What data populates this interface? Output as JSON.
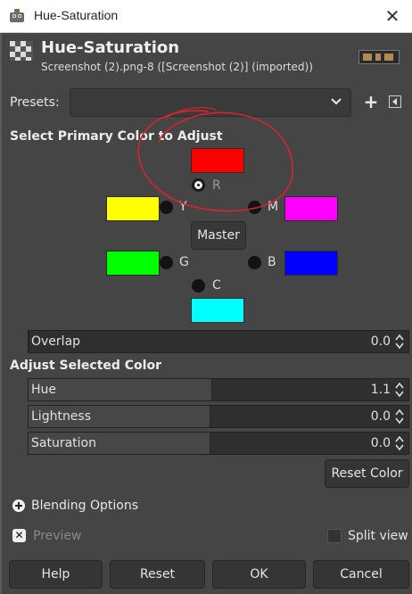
{
  "window": {
    "title": "Hue-Saturation",
    "close_icon": "close-icon"
  },
  "header": {
    "title": "Hue-Saturation",
    "subtitle": "Screenshot (2).png-8 ([Screenshot (2)] (imported))"
  },
  "presets": {
    "label": "Presets:",
    "value": ""
  },
  "primary_section": {
    "title": "Select Primary Color to Adjust",
    "colors": [
      {
        "key": "red",
        "label": "R",
        "hex": "#ff0000",
        "selected": true
      },
      {
        "key": "yellow",
        "label": "Y",
        "hex": "#ffff00",
        "selected": false
      },
      {
        "key": "magenta",
        "label": "M",
        "hex": "#ff00ff",
        "selected": false
      },
      {
        "key": "green",
        "label": "G",
        "hex": "#00ff00",
        "selected": false
      },
      {
        "key": "blue",
        "label": "B",
        "hex": "#0000ff",
        "selected": false
      },
      {
        "key": "cyan",
        "label": "C",
        "hex": "#00ffff",
        "selected": false
      }
    ],
    "master_label": "Master",
    "annotation_color": "#d9232e"
  },
  "overlap": {
    "label": "Overlap",
    "value": "0.0",
    "fill_fraction": 0.0
  },
  "adjust_section": {
    "title": "Adjust Selected Color",
    "sliders": [
      {
        "key": "hue",
        "label": "Hue",
        "value": "1.1",
        "fill_fraction": 0.5
      },
      {
        "key": "lightness",
        "label": "Lightness",
        "value": "0.0",
        "fill_fraction": 0.5
      },
      {
        "key": "saturation",
        "label": "Saturation",
        "value": "0.0",
        "fill_fraction": 0.5
      }
    ],
    "reset_color_label": "Reset Color"
  },
  "blending": {
    "label": "Blending Options"
  },
  "preview": {
    "label": "Preview",
    "checked": true
  },
  "split_view": {
    "label": "Split view",
    "checked": false
  },
  "footer": {
    "help": "Help",
    "reset": "Reset",
    "ok": "OK",
    "cancel": "Cancel"
  }
}
